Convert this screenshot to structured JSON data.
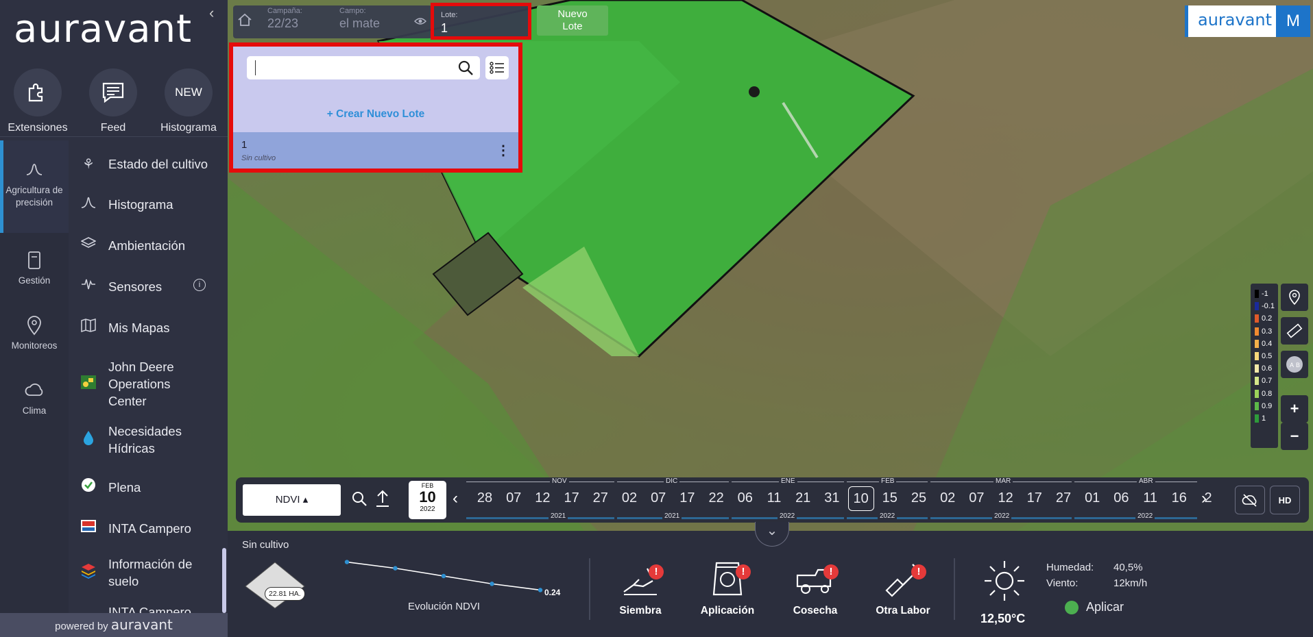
{
  "sidebar": {
    "logo": "auravant",
    "collapse": "‹",
    "quick": [
      {
        "label": "Extensiones",
        "icon": "puzzle-icon"
      },
      {
        "label": "Feed",
        "icon": "chat-icon"
      },
      {
        "label": "Histograma",
        "badge": "NEW"
      }
    ],
    "categories": [
      {
        "label": "Agricultura de precisión",
        "icon": "wave-icon"
      },
      {
        "label": "Gestión",
        "icon": "notebook-icon"
      },
      {
        "label": "Monitoreos",
        "icon": "location-icon"
      },
      {
        "label": "Clima",
        "icon": "cloud-icon"
      }
    ],
    "menu": [
      {
        "label": "Estado del cultivo",
        "icon": "plant-icon"
      },
      {
        "label": "Histograma",
        "icon": "bell-curve-icon"
      },
      {
        "label": "Ambientación",
        "icon": "layers-icon"
      },
      {
        "label": "Sensores",
        "icon": "pulse-icon",
        "info": "i"
      },
      {
        "label": "Mis Mapas",
        "icon": "map-icon"
      },
      {
        "label": "John Deere Operations Center",
        "icon": "tractor-icon"
      },
      {
        "label": "Necesidades Hídricas",
        "icon": "drop-icon"
      },
      {
        "label": "Plena",
        "icon": "check-circle-icon"
      },
      {
        "label": "INTA Campero",
        "icon": "inta-icon"
      },
      {
        "label": "Información de suelo",
        "icon": "stack-icon"
      },
      {
        "label": "INTA Campero",
        "icon": "inta-icon"
      }
    ],
    "powered_by": "powered by",
    "powered_brand": "auravant"
  },
  "topbar": {
    "campana_label": "Campaña:",
    "campana_value": "22/23",
    "campo_label": "Campo:",
    "campo_value": "el mate",
    "lote_label": "Lote:",
    "lote_value": "1",
    "nuevo_lote": "Nuevo Lote"
  },
  "lote_panel": {
    "search_placeholder": "",
    "crear": "+ Crear Nuevo Lote",
    "rows": [
      {
        "name": "1",
        "status": "Sin cultivo"
      }
    ]
  },
  "brand": {
    "name": "auravant",
    "avatar": "M"
  },
  "legend": {
    "items": [
      {
        "label": "-1",
        "color": "#000000"
      },
      {
        "label": "-0.1",
        "color": "#1a2a9c"
      },
      {
        "label": "0.2",
        "color": "#e05a2a"
      },
      {
        "label": "0.3",
        "color": "#f08a30"
      },
      {
        "label": "0.4",
        "color": "#f4b04a"
      },
      {
        "label": "0.5",
        "color": "#f6d77a"
      },
      {
        "label": "0.6",
        "color": "#f2e8a8"
      },
      {
        "label": "0.7",
        "color": "#d4e68a"
      },
      {
        "label": "0.8",
        "color": "#9bd25a"
      },
      {
        "label": "0.9",
        "color": "#5cb948"
      },
      {
        "label": "1",
        "color": "#2e9a3a"
      }
    ]
  },
  "timeline": {
    "layer": "NDVI ▴",
    "current": {
      "month": "FEB",
      "day": "10",
      "year": "2022"
    },
    "days": [
      "28",
      "07",
      "12",
      "17",
      "27",
      "02",
      "07",
      "17",
      "22",
      "06",
      "11",
      "21",
      "31",
      "10",
      "15",
      "25",
      "02",
      "07",
      "12",
      "17",
      "27",
      "01",
      "06",
      "11",
      "16",
      "2"
    ],
    "months": [
      "NOV",
      "DIC",
      "ENE",
      "FEB",
      "MAR",
      "ABR"
    ],
    "years": [
      "2021",
      "2021",
      "2022",
      "2022",
      "2022",
      "2022"
    ],
    "hd": "HD"
  },
  "bottom": {
    "crop_status": "Sin cultivo",
    "area": "22.81 HA.",
    "ndvi_value": "0.24",
    "ndvi_label": "Evolución NDVI",
    "ndvi_series": [
      0.42,
      0.38,
      0.33,
      0.28,
      0.24
    ],
    "labores": [
      {
        "label": "Siembra",
        "icon": "seeding-hand-icon"
      },
      {
        "label": "Aplicación",
        "icon": "spray-bag-icon"
      },
      {
        "label": "Cosecha",
        "icon": "harvester-icon"
      },
      {
        "label": "Otra Labor",
        "icon": "shovel-icon"
      }
    ],
    "warning": "!",
    "temperature": "12,50°C",
    "humidity_label": "Humedad:",
    "humidity_value": "40,5%",
    "wind_label": "Viento:",
    "wind_value": "12km/h",
    "apply": "Aplicar"
  }
}
